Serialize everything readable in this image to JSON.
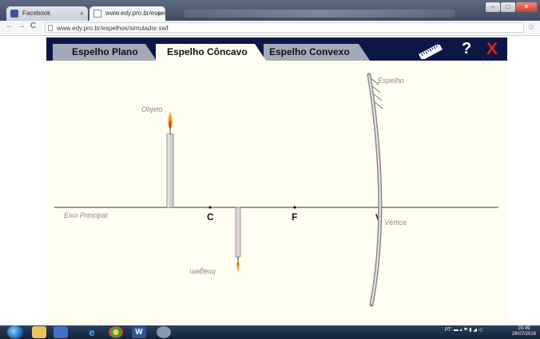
{
  "browser": {
    "tabs": [
      {
        "label": "Facebook",
        "active": false
      },
      {
        "label": "www.edy.pro.br/espelhos",
        "active": true
      }
    ],
    "url": "www.edy.pro.br/espelhos/simulador.swf"
  },
  "simulator": {
    "tabs": [
      {
        "label": "Espelho Plano",
        "active": false
      },
      {
        "label": "Espelho Côncavo",
        "active": true
      },
      {
        "label": "Espelho Convexo",
        "active": false
      }
    ],
    "icons": {
      "ruler": "ruler-icon",
      "help": "?",
      "close": "X"
    },
    "labels": {
      "objeto": "Objeto",
      "imagem": "Imagem",
      "espelho": "Espelho",
      "eixo": "Eixo Principal",
      "vertice": "Vértice",
      "c": "C",
      "f": "F",
      "v": "V"
    },
    "colors": {
      "header": "#0d1746",
      "background": "#fffef0",
      "close": "#e0211b"
    }
  },
  "taskbar": {
    "tray_lang": "PT",
    "time": "20:49",
    "date": "26/07/2016"
  }
}
